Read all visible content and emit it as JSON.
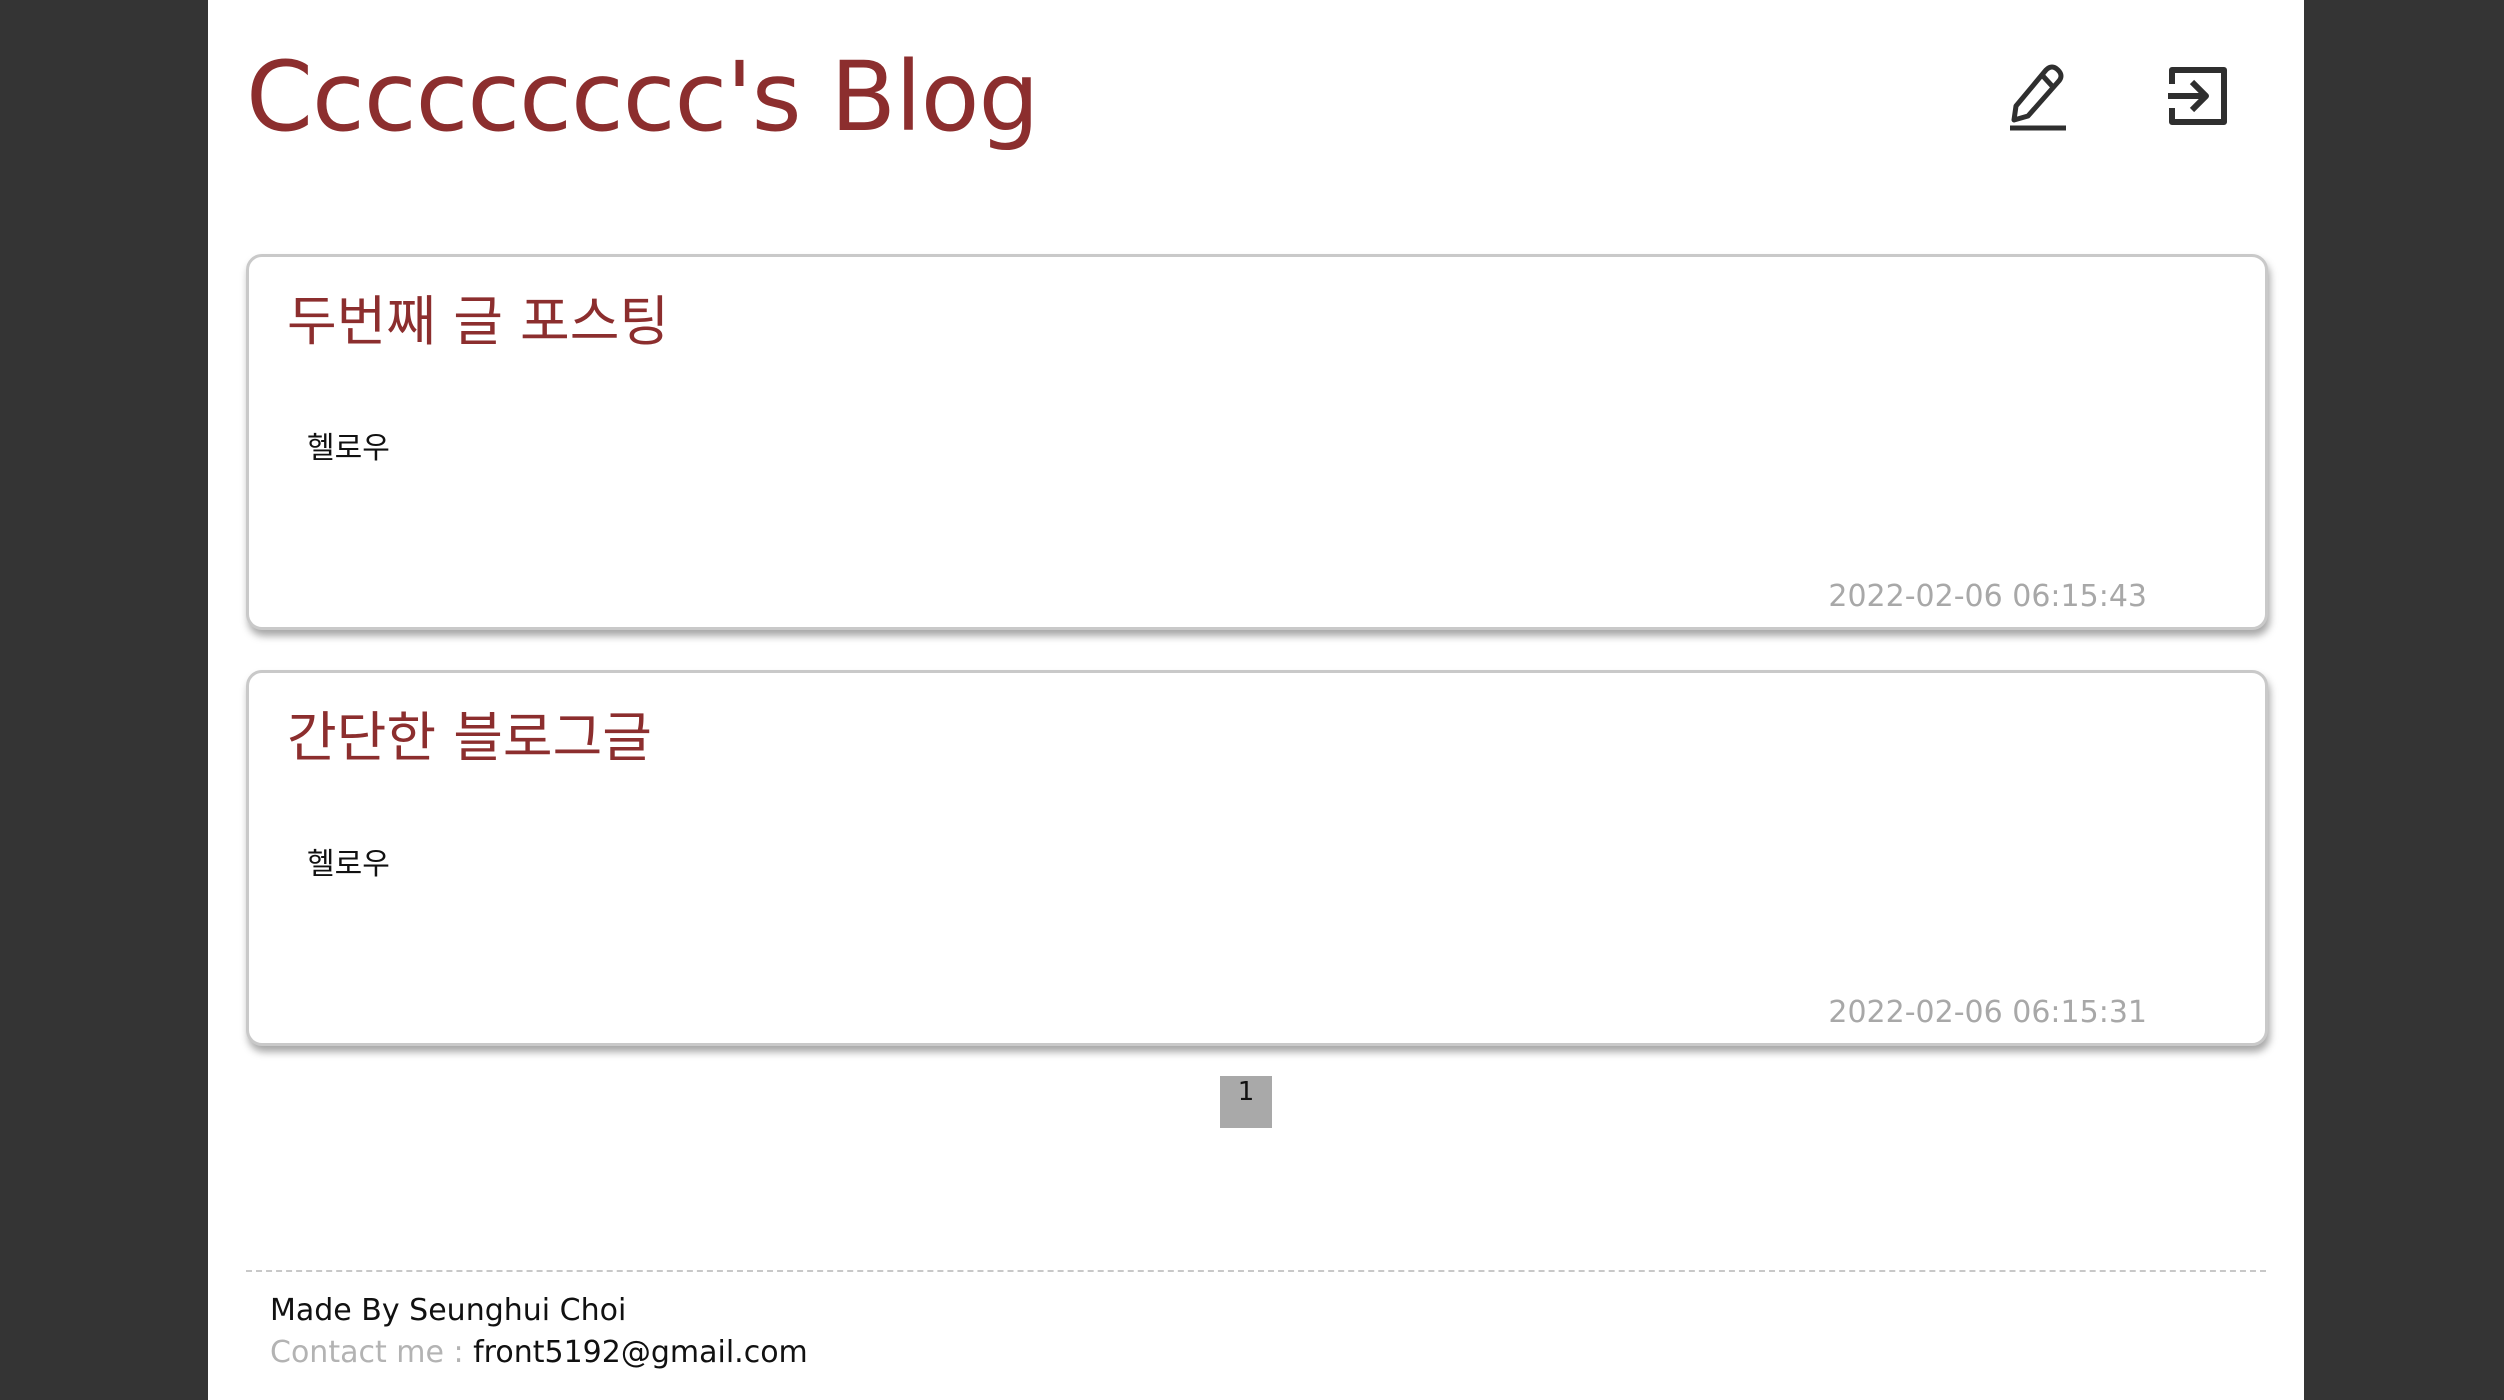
{
  "header": {
    "title": "Ccccccccc's Blog",
    "write_icon": "pencil-icon",
    "logout_icon": "logout-icon"
  },
  "posts": [
    {
      "title": "두번째 글 포스팅",
      "body": "헬로우",
      "date": "2022-02-06 06:15:43"
    },
    {
      "title": "간단한 블로그글",
      "body": "헬로우",
      "date": "2022-02-06 06:15:31"
    }
  ],
  "pagination": {
    "current": "1"
  },
  "footer": {
    "made_by": "Made By Seunghui Choi",
    "contact_label": "Contact me : ",
    "contact_email": "front5192@gmail.com"
  },
  "colors": {
    "accent": "#8c2e2e",
    "background": "#343434",
    "date_text": "#a8a8a8"
  }
}
